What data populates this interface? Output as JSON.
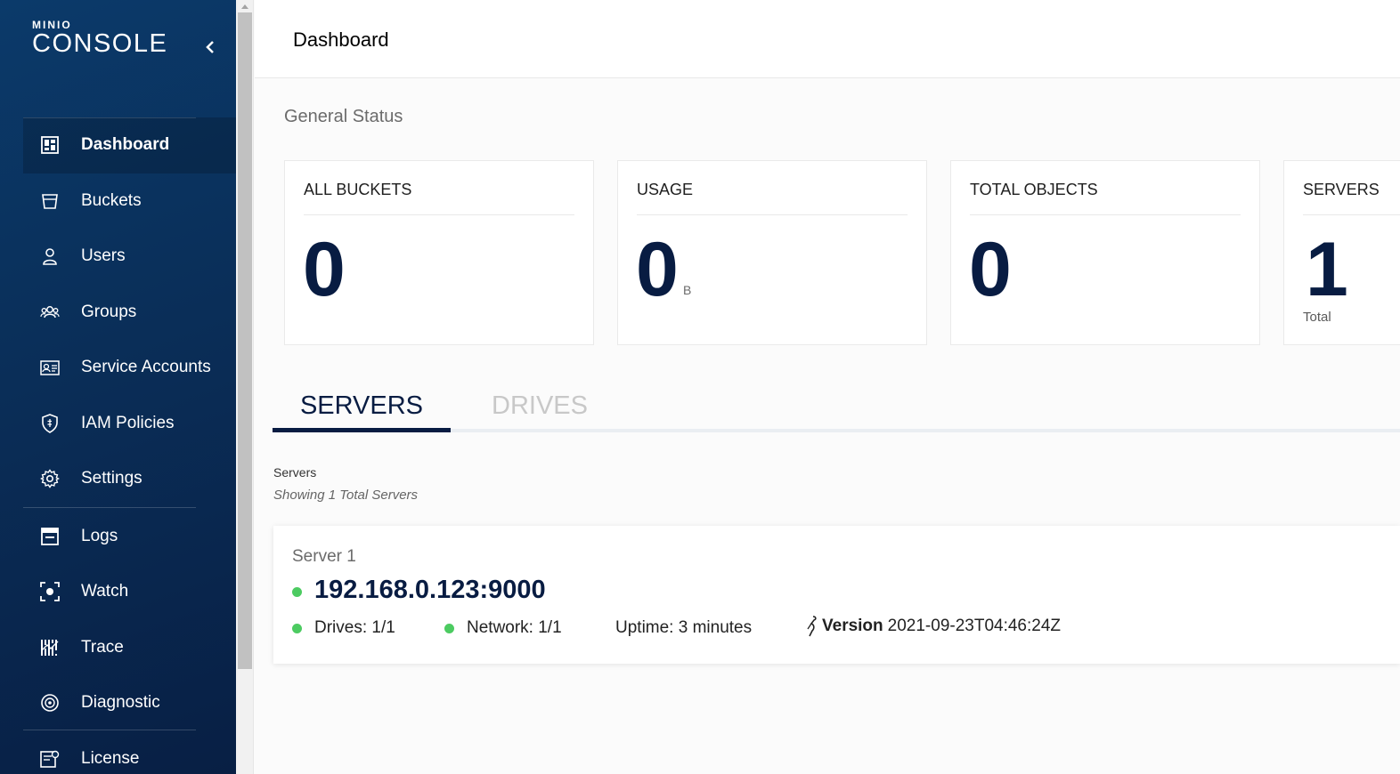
{
  "brand": {
    "small": "MINIO",
    "big": "CONSOLE"
  },
  "sidebar": {
    "items": [
      {
        "label": "Dashboard",
        "icon": "dashboard-icon",
        "active": true
      },
      {
        "label": "Buckets",
        "icon": "bucket-icon"
      },
      {
        "label": "Users",
        "icon": "user-icon"
      },
      {
        "label": "Groups",
        "icon": "groups-icon"
      },
      {
        "label": "Service Accounts",
        "icon": "service-accounts-icon"
      },
      {
        "label": "IAM Policies",
        "icon": "shield-icon"
      },
      {
        "label": "Settings",
        "icon": "gear-icon"
      },
      {
        "label": "Logs",
        "icon": "logs-icon"
      },
      {
        "label": "Watch",
        "icon": "watch-icon"
      },
      {
        "label": "Trace",
        "icon": "trace-icon"
      },
      {
        "label": "Diagnostic",
        "icon": "diagnostic-icon"
      },
      {
        "label": "License",
        "icon": "license-icon"
      }
    ]
  },
  "header": {
    "title": "Dashboard"
  },
  "status": {
    "title": "General Status",
    "cards": [
      {
        "title": "ALL BUCKETS",
        "value": "0"
      },
      {
        "title": "USAGE",
        "value": "0",
        "unit": "B"
      },
      {
        "title": "TOTAL OBJECTS",
        "value": "0"
      },
      {
        "title": "SERVERS",
        "value": "1",
        "sub": "Total"
      }
    ]
  },
  "tabs": [
    {
      "label": "SERVERS",
      "active": true
    },
    {
      "label": "DRIVES",
      "active": false
    }
  ],
  "servers": {
    "label": "Servers",
    "count_text": "Showing 1 Total Servers",
    "list": [
      {
        "name": "Server 1",
        "endpoint": "192.168.0.123:9000",
        "drives": "Drives: 1/1",
        "network": "Network: 1/1",
        "uptime": "Uptime: 3 minutes",
        "version_label": "Version",
        "version": "2021-09-23T04:46:24Z"
      }
    ]
  },
  "colors": {
    "accent": "#081c42",
    "online": "#4ccb61",
    "sidebar": "#0a2e58"
  }
}
